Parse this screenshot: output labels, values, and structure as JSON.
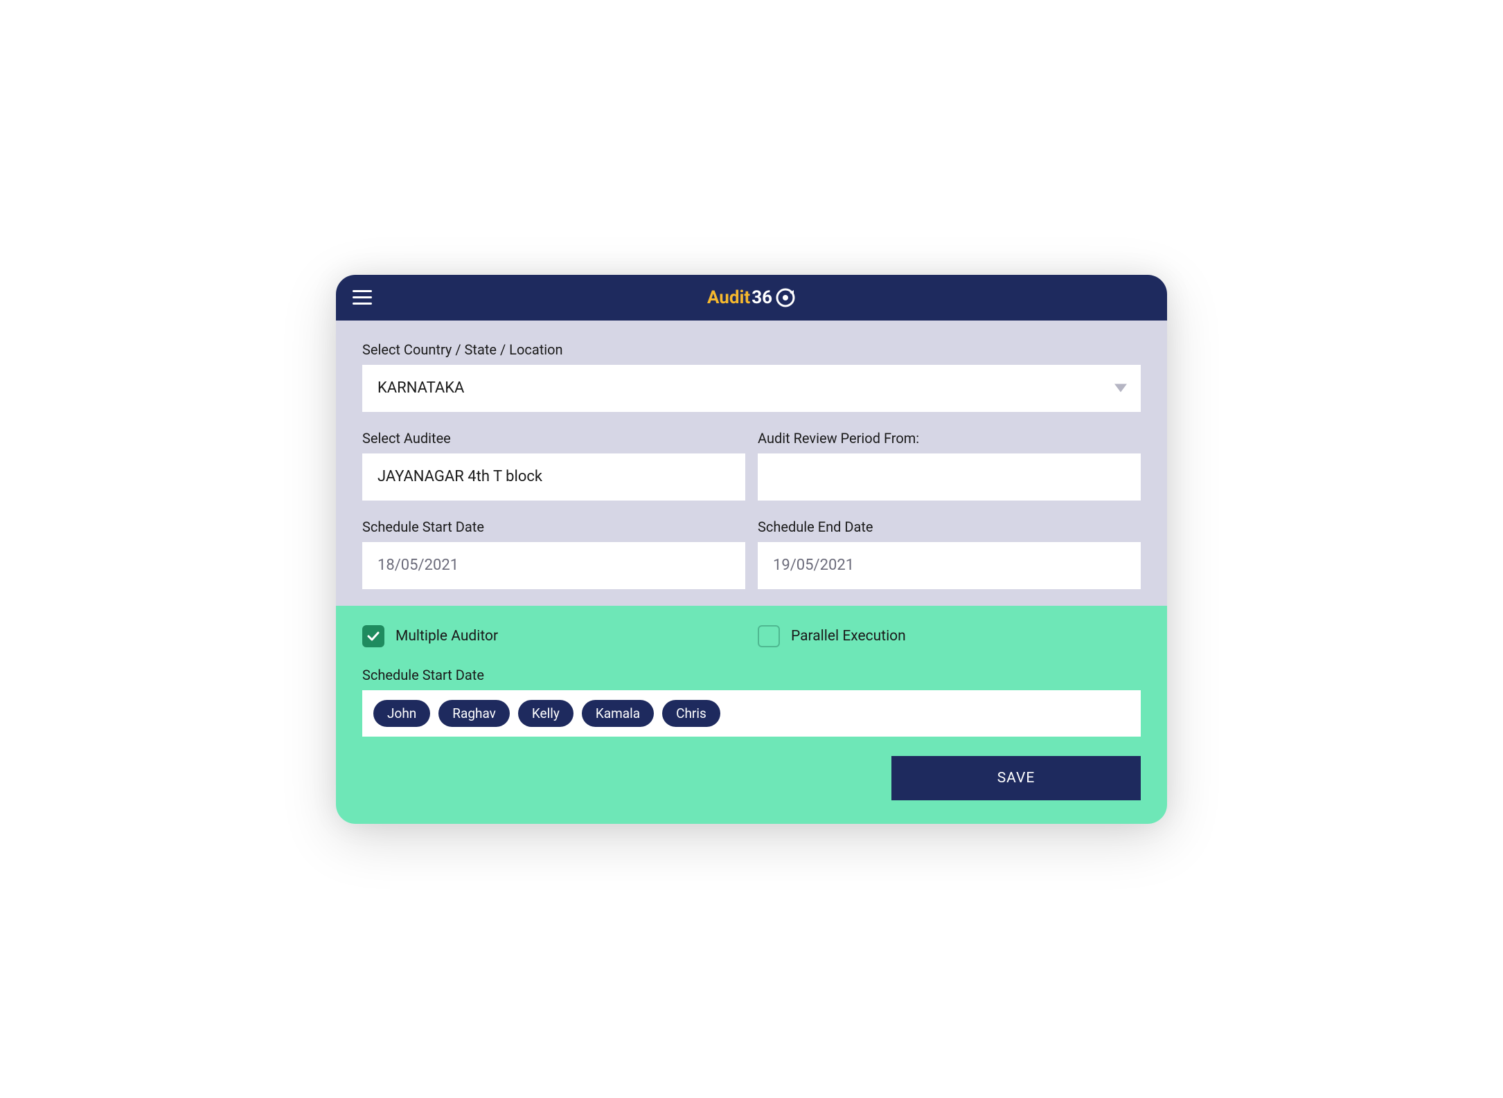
{
  "header": {
    "logo_part1": "Audit",
    "logo_part2": "36"
  },
  "form": {
    "country_label": "Select Country / State / Location",
    "country_value": "KARNATAKA",
    "auditee_label": "Select Auditee",
    "auditee_value": "JAYANAGAR 4th T block",
    "review_period_label": "Audit Review Period From:",
    "review_period_value": "",
    "start_date_label": "Schedule Start Date",
    "start_date_value": "18/05/2021",
    "end_date_label": "Schedule End Date",
    "end_date_value": "19/05/2021"
  },
  "options": {
    "multiple_auditor_label": "Multiple Auditor",
    "multiple_auditor_checked": true,
    "parallel_execution_label": "Parallel Execution",
    "parallel_execution_checked": false,
    "tags_label": "Schedule Start Date",
    "tags": [
      "John",
      "Raghav",
      "Kelly",
      "Kamala",
      "Chris"
    ]
  },
  "actions": {
    "save_label": "SAVE"
  },
  "colors": {
    "header_bg": "#1e2a5e",
    "accent_yellow": "#f5b82e",
    "form_bg": "#d6d6e5",
    "green_bg": "#6ee7b7",
    "checkbox_checked": "#1f8b5f"
  }
}
